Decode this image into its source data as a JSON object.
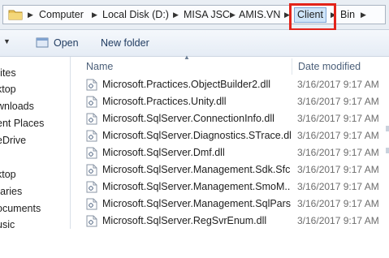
{
  "address": {
    "crumbs": [
      "Computer",
      "Local Disk (D:)",
      "MISA JSC",
      "AMIS.VN",
      "Client",
      "Bin"
    ],
    "highlighted_crumb": "Client",
    "highlight_color": "#e2231a"
  },
  "toolbar": {
    "open_label": "Open",
    "new_folder_label": "New folder"
  },
  "nav": {
    "items": [
      "rites",
      "ktop",
      "wnloads",
      "ent Places",
      "eDrive",
      "",
      "ktop",
      "raries",
      "ocuments",
      "usic"
    ]
  },
  "file_list": {
    "columns": {
      "name": "Name",
      "date_modified": "Date modified"
    },
    "rows": [
      {
        "name": "Microsoft.Practices.ObjectBuilder2.dll",
        "date": "3/16/2017 9:17 AM"
      },
      {
        "name": "Microsoft.Practices.Unity.dll",
        "date": "3/16/2017 9:17 AM"
      },
      {
        "name": "Microsoft.SqlServer.ConnectionInfo.dll",
        "date": "3/16/2017 9:17 AM"
      },
      {
        "name": "Microsoft.SqlServer.Diagnostics.STrace.dll",
        "date": "3/16/2017 9:17 AM"
      },
      {
        "name": "Microsoft.SqlServer.Dmf.dll",
        "date": "3/16/2017 9:17 AM"
      },
      {
        "name": "Microsoft.SqlServer.Management.Sdk.Sfc...",
        "date": "3/16/2017 9:17 AM"
      },
      {
        "name": "Microsoft.SqlServer.Management.SmoM...",
        "date": "3/16/2017 9:17 AM"
      },
      {
        "name": "Microsoft.SqlServer.Management.SqlPars...",
        "date": "3/16/2017 9:17 AM"
      },
      {
        "name": "Microsoft.SqlServer.RegSvrEnum.dll",
        "date": "3/16/2017 9:17 AM"
      }
    ]
  },
  "icons": {
    "folder": "folder-icon",
    "open": "open-icon",
    "dll": "dll-file-icon",
    "sort": "sort-up-icon"
  }
}
